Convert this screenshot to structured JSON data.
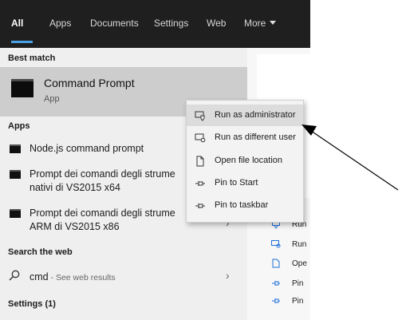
{
  "tabs": [
    {
      "label": "All"
    },
    {
      "label": "Apps"
    },
    {
      "label": "Documents"
    },
    {
      "label": "Settings"
    },
    {
      "label": "Web"
    },
    {
      "label": "More"
    }
  ],
  "sections": {
    "best_match": "Best match",
    "apps": "Apps",
    "search_web": "Search the web",
    "settings": "Settings (1)"
  },
  "best_match": {
    "title": "Command Prompt",
    "subtitle": "App"
  },
  "apps": [
    {
      "line1": "Node.js command prompt",
      "line2": ""
    },
    {
      "line1": "Prompt dei comandi degli strume",
      "line2": "nativi di VS2015 x64"
    },
    {
      "line1": "Prompt dei comandi degli strume",
      "line2": "ARM di VS2015 x86"
    }
  ],
  "web_search": {
    "query": "cmd",
    "suffix": " - See web results"
  },
  "context_menu": {
    "items": [
      {
        "label": "Run as administrator",
        "icon": "shield-window-icon"
      },
      {
        "label": "Run as different user",
        "icon": "user-window-icon"
      },
      {
        "label": "Open file location",
        "icon": "file-icon"
      },
      {
        "label": "Pin to Start",
        "icon": "pin-icon"
      },
      {
        "label": "Pin to taskbar",
        "icon": "pin-icon"
      }
    ]
  },
  "preview_actions": [
    {
      "label": "Run",
      "icon": "run-icon"
    },
    {
      "label": "Run",
      "icon": "user-window-icon"
    },
    {
      "label": "Ope",
      "icon": "file-icon"
    },
    {
      "label": "Pin",
      "icon": "pin-icon"
    },
    {
      "label": "Pin",
      "icon": "pin-icon"
    }
  ],
  "colors": {
    "topbar": "#1f1f1f",
    "accent": "#4a9fe5",
    "selected": "#cdcdcd",
    "menu_highlight": "#dcdcdc"
  }
}
